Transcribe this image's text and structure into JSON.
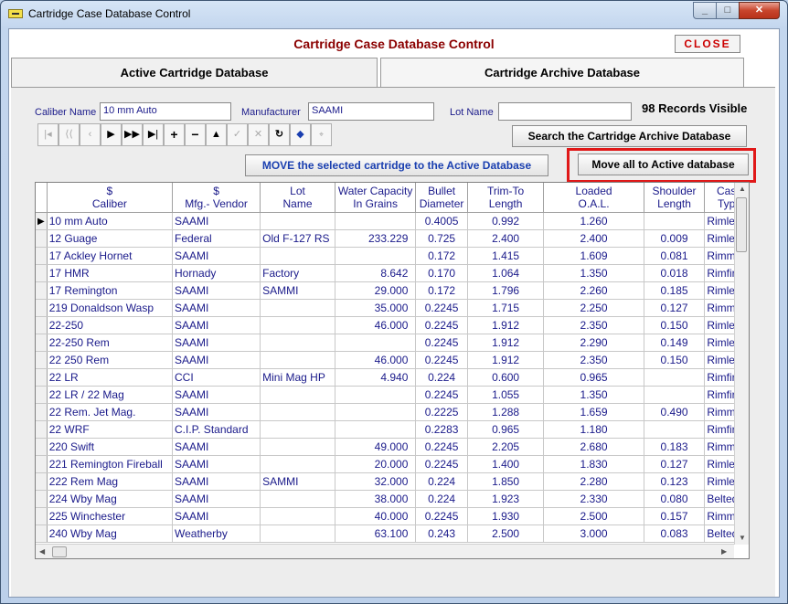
{
  "window": {
    "title": "Cartridge Case Database Control"
  },
  "header": {
    "title": "Cartridge Case Database Control",
    "close_label": "CLOSE"
  },
  "tabs": [
    {
      "label": "Active Cartridge Database"
    },
    {
      "label": "Cartridge Archive Database"
    }
  ],
  "filters": {
    "caliber_label": "Caliber Name",
    "caliber_value": "10 mm Auto",
    "manufacturer_label": "Manufacturer",
    "manufacturer_value": "SAAMI",
    "lot_label": "Lot Name",
    "lot_value": ""
  },
  "records_visible": "98 Records Visible",
  "buttons": {
    "search_archive": "Search the Cartridge Archive Database",
    "move_selected": "MOVE the selected cartridge to the Active Database",
    "move_all": "Move all to Active database"
  },
  "colors": {
    "accent_red": "#e01818",
    "title_red": "#8b0000",
    "text_blue": "#1a1a8a"
  },
  "table": {
    "columns": [
      {
        "line1": "$",
        "line2": "Caliber"
      },
      {
        "line1": "$",
        "line2": "Mfg.- Vendor"
      },
      {
        "line1": "Lot",
        "line2": "Name"
      },
      {
        "line1": "Water Capacity",
        "line2": "In Grains"
      },
      {
        "line1": "Bullet",
        "line2": "Diameter"
      },
      {
        "line1": "Trim-To",
        "line2": "Length"
      },
      {
        "line1": "Loaded",
        "line2": "O.A.L."
      },
      {
        "line1": "Shoulder",
        "line2": "Length"
      },
      {
        "line1": "Cas",
        "line2": "Typ"
      }
    ],
    "rows": [
      [
        "10 mm Auto",
        "SAAMI",
        "",
        "",
        "0.4005",
        "0.992",
        "1.260",
        "",
        "Rimles"
      ],
      [
        "12 Guage",
        "Federal",
        "Old F-127 RS",
        "233.229",
        "0.725",
        "2.400",
        "2.400",
        "0.009",
        "Rimles"
      ],
      [
        "17 Ackley Hornet",
        "SAAMI",
        "",
        "",
        "0.172",
        "1.415",
        "1.609",
        "0.081",
        "Rimme"
      ],
      [
        "17 HMR",
        "Hornady",
        "Factory",
        "8.642",
        "0.170",
        "1.064",
        "1.350",
        "0.018",
        "Rimfire"
      ],
      [
        "17 Remington",
        "SAAMI",
        "SAMMI",
        "29.000",
        "0.172",
        "1.796",
        "2.260",
        "0.185",
        "Rimles"
      ],
      [
        "219  Donaldson Wasp",
        "SAAMI",
        "",
        "35.000",
        "0.2245",
        "1.715",
        "2.250",
        "0.127",
        "Rimme"
      ],
      [
        "22-250",
        "SAAMI",
        "",
        "46.000",
        "0.2245",
        "1.912",
        "2.350",
        "0.150",
        "Rimles"
      ],
      [
        "22-250 Rem",
        "SAAMI",
        "",
        "",
        "0.2245",
        "1.912",
        "2.290",
        "0.149",
        "Rimles"
      ],
      [
        "22 250 Rem",
        "SAAMI",
        "",
        "46.000",
        "0.2245",
        "1.912",
        "2.350",
        "0.150",
        "Rimles"
      ],
      [
        "22 LR",
        "CCI",
        "Mini Mag HP",
        "4.940",
        "0.224",
        "0.600",
        "0.965",
        "",
        "Rimfire"
      ],
      [
        "22 LR / 22 Mag",
        "SAAMI",
        "",
        "",
        "0.2245",
        "1.055",
        "1.350",
        "",
        "Rimfire"
      ],
      [
        "22 Rem. Jet Mag.",
        "SAAMI",
        "",
        "",
        "0.2225",
        "1.288",
        "1.659",
        "0.490",
        "Rimme"
      ],
      [
        "22 WRF",
        "C.I.P. Standard",
        "",
        "",
        "0.2283",
        "0.965",
        "1.180",
        "",
        "Rimfire"
      ],
      [
        "220 Swift",
        "SAAMI",
        "",
        "49.000",
        "0.2245",
        "2.205",
        "2.680",
        "0.183",
        "Rimme"
      ],
      [
        "221 Remington  Fireball",
        "SAAMI",
        "",
        "20.000",
        "0.2245",
        "1.400",
        "1.830",
        "0.127",
        "Rimles"
      ],
      [
        "222 Rem Mag",
        "SAAMI",
        "SAMMI",
        "32.000",
        "0.224",
        "1.850",
        "2.280",
        "0.123",
        "Rimles"
      ],
      [
        "224 Wby Mag",
        "SAAMI",
        "",
        "38.000",
        "0.224",
        "1.923",
        "2.330",
        "0.080",
        "Belted"
      ],
      [
        "225 Winchester",
        "SAAMI",
        "",
        "40.000",
        "0.2245",
        "1.930",
        "2.500",
        "0.157",
        "Rimme"
      ],
      [
        "240 Wby Mag",
        "Weatherby",
        "",
        "63.100",
        "0.243",
        "2.500",
        "3.000",
        "0.083",
        "Belted"
      ]
    ]
  }
}
